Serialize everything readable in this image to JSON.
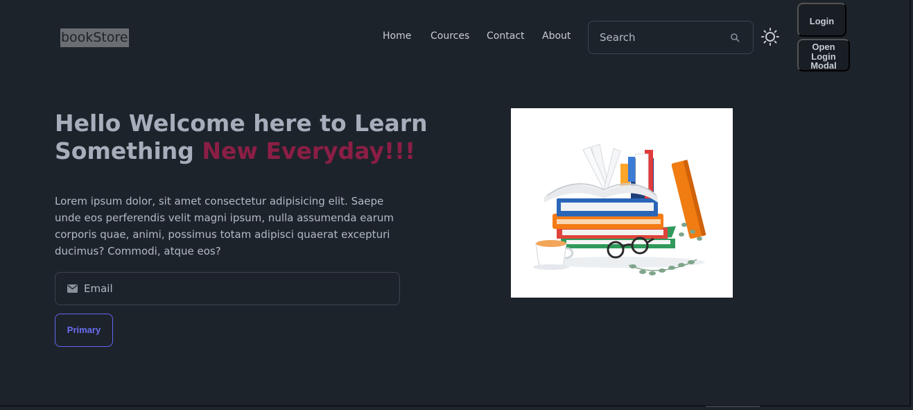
{
  "header": {
    "brand": "bookStore",
    "nav": [
      "Home",
      "Cources",
      "Contact",
      "About"
    ],
    "search_placeholder": "Search",
    "login_label": "Login",
    "modal_label_lines": [
      "Open",
      "Login",
      "Modal"
    ]
  },
  "hero": {
    "headline_part1": "Hello Welcome here to Learn Something ",
    "headline_accent": "New Everyday!!!",
    "paragraph": "Lorem ipsum dolor, sit amet consectetur adipisicing elit. Saepe unde eos perferendis velit magni ipsum, nulla assumenda earum corporis quae, animi, possimus totam adipisci quaerat excepturi ducimus? Commodi, atque eos?",
    "email_placeholder": "Email",
    "primary_label": "Primary"
  },
  "colors": {
    "background": "#1d232a",
    "accent_text": "#8b1e45",
    "primary_button": "#6366f1"
  },
  "icons": {
    "search": "search-icon",
    "theme": "sun-icon",
    "email": "envelope-icon"
  }
}
